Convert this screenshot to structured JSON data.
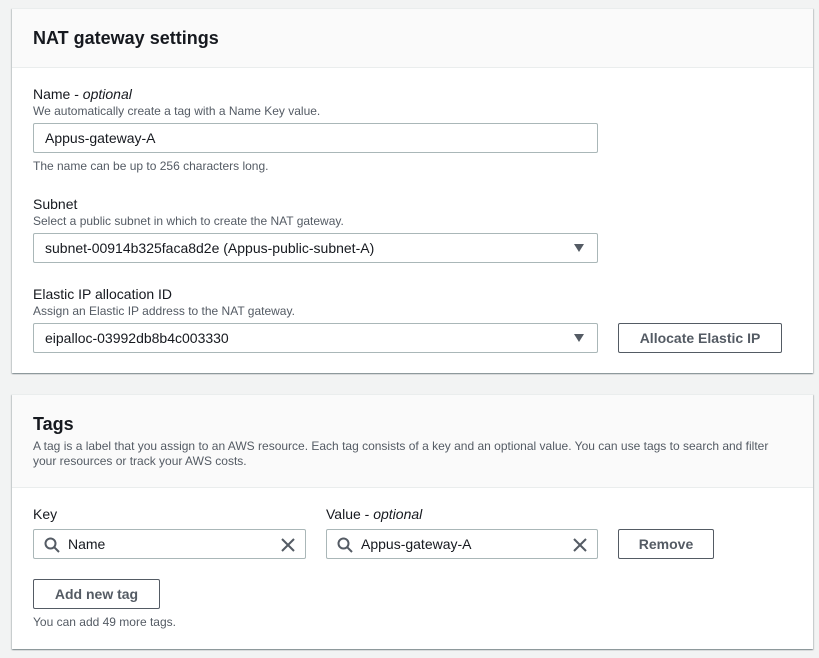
{
  "nat_settings": {
    "title": "NAT gateway settings",
    "name_label": "Name - ",
    "name_optional": "optional",
    "name_description": "We automatically create a tag with a Name Key value.",
    "name_value": "Appus-gateway-A",
    "name_hint": "The name can be up to 256 characters long.",
    "subnet_label": "Subnet",
    "subnet_description": "Select a public subnet in which to create the NAT gateway.",
    "subnet_value": "subnet-00914b325faca8d2e (Appus-public-subnet-A)",
    "eip_label": "Elastic IP allocation ID",
    "eip_description": "Assign an Elastic IP address to the NAT gateway.",
    "eip_value": "eipalloc-03992db8b4c003330",
    "allocate_button": "Allocate Elastic IP"
  },
  "tags": {
    "title": "Tags",
    "description_line1": "A tag is a label that you assign to an AWS resource. Each tag consists of a key and an optional value. You can use tags to search and filter",
    "description_line2": "your resources or track your AWS costs.",
    "key_label": "Key",
    "value_label": "Value - ",
    "value_optional": "optional",
    "rows": [
      {
        "key": "Name",
        "value": "Appus-gateway-A",
        "remove_label": "Remove"
      }
    ],
    "add_button": "Add new tag",
    "remaining_hint": "You can add 49 more tags."
  },
  "icons": {
    "search": "search-icon",
    "clear": "close-icon",
    "dropdown": "caret-down-icon"
  },
  "colors": {
    "text": "#16191f",
    "secondary_text": "#545b64",
    "border": "#aab7b8",
    "background": "#f2f3f3"
  }
}
